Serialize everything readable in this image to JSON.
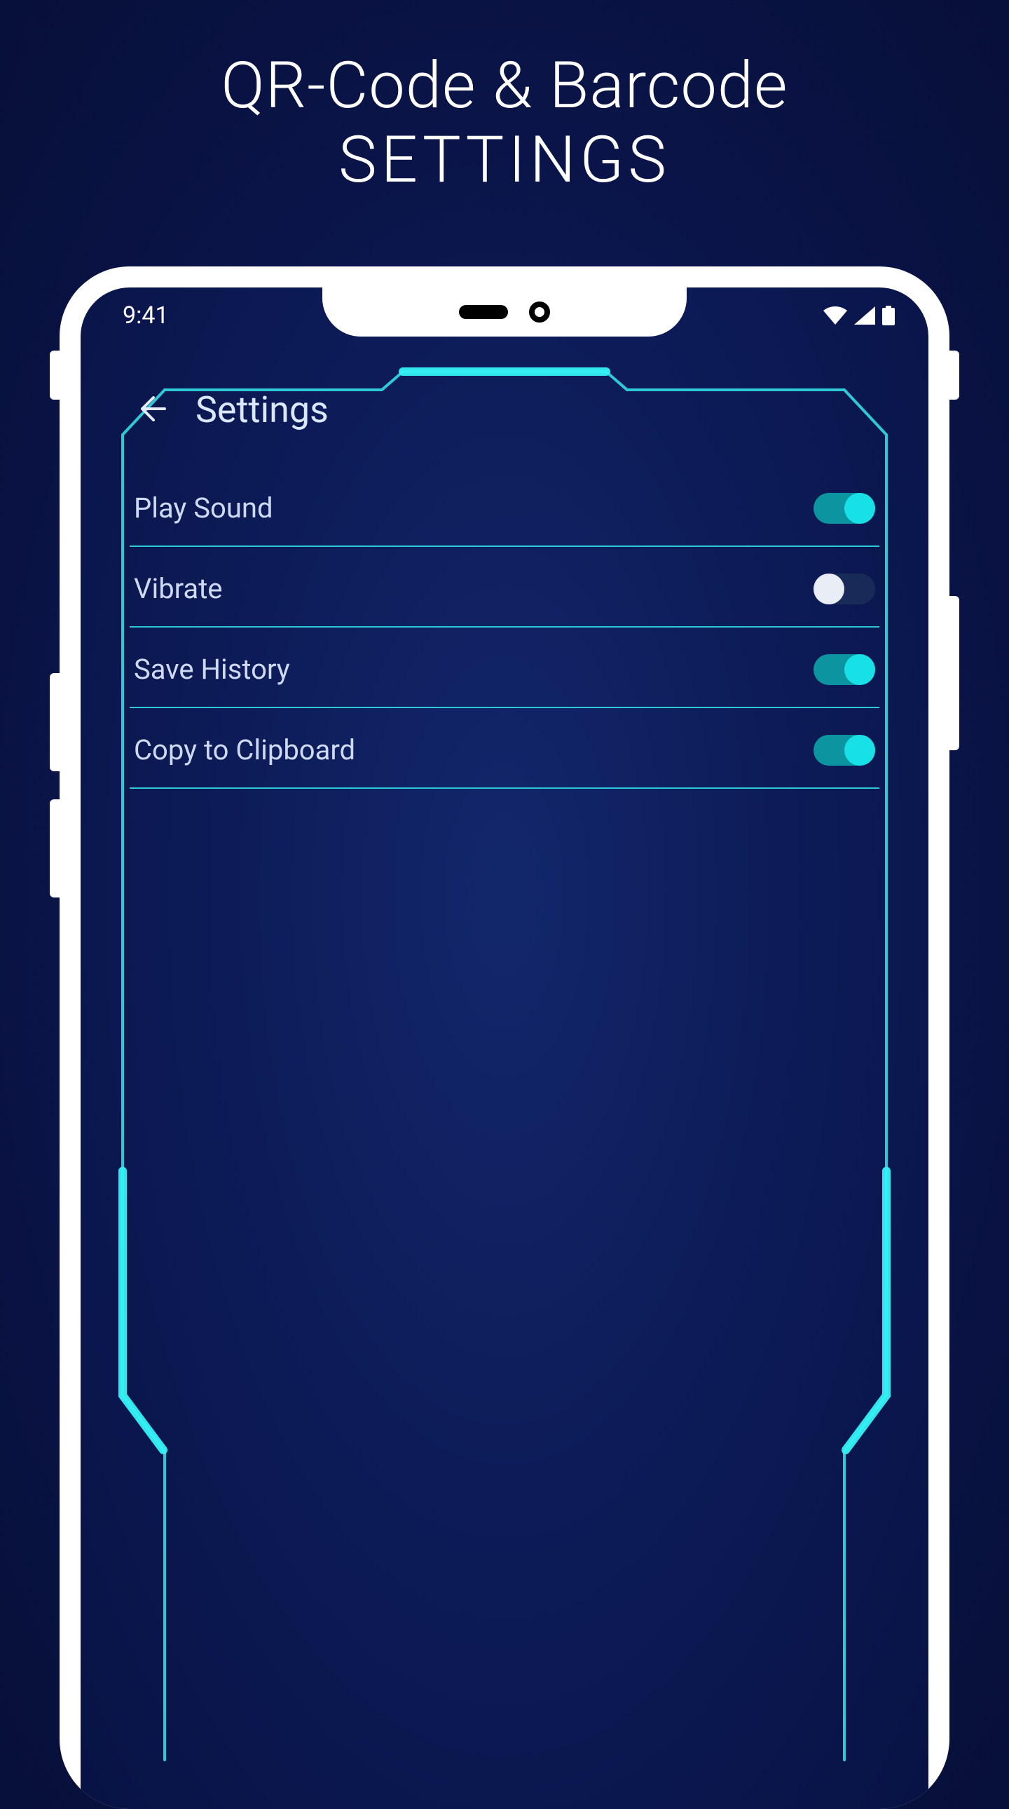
{
  "promo": {
    "line1": "QR-Code & Barcode",
    "line2": "SETTINGS"
  },
  "status": {
    "time": "9:41"
  },
  "header": {
    "title": "Settings"
  },
  "settings": {
    "items": [
      {
        "label": "Play Sound",
        "on": true
      },
      {
        "label": "Vibrate",
        "on": false
      },
      {
        "label": "Save History",
        "on": true
      },
      {
        "label": "Copy to Clipboard",
        "on": true
      }
    ]
  },
  "colors": {
    "accent": "#17e1e6",
    "frame": "#2ec8d6"
  }
}
